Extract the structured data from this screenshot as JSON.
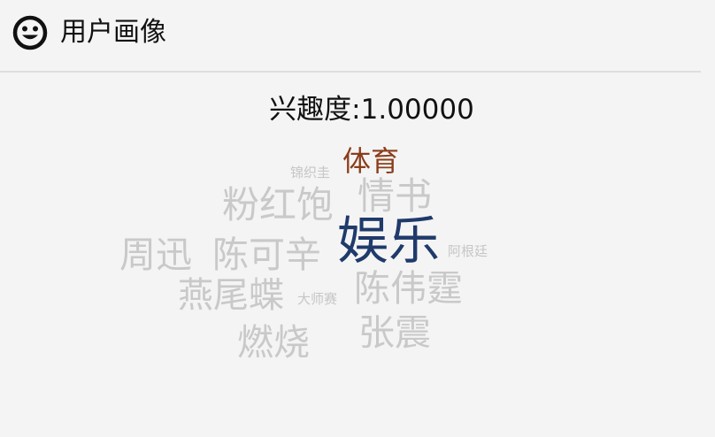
{
  "header": {
    "icon": "smiley-face-icon",
    "title": "用户画像"
  },
  "interest": {
    "label": "兴趣度:1.00000"
  },
  "wordcloud": {
    "words": [
      {
        "text": "体育",
        "color": "#8a3d1a"
      },
      {
        "text": "锦织圭",
        "color": "#c6c6c6"
      },
      {
        "text": "粉红饱",
        "color": "#c9c9c9"
      },
      {
        "text": "情书",
        "color": "#c9c9c9"
      },
      {
        "text": "娱乐",
        "color": "#1f3a6b"
      },
      {
        "text": "周迅",
        "color": "#c9c9c9"
      },
      {
        "text": "陈可辛",
        "color": "#c9c9c9"
      },
      {
        "text": "阿根廷",
        "color": "#c6c6c6"
      },
      {
        "text": "燕尾蝶",
        "color": "#c9c9c9"
      },
      {
        "text": "大师赛",
        "color": "#c6c6c6"
      },
      {
        "text": "陈伟霆",
        "color": "#c9c9c9"
      },
      {
        "text": "燃烧",
        "color": "#c9c9c9"
      },
      {
        "text": "张震",
        "color": "#c9c9c9"
      }
    ]
  }
}
